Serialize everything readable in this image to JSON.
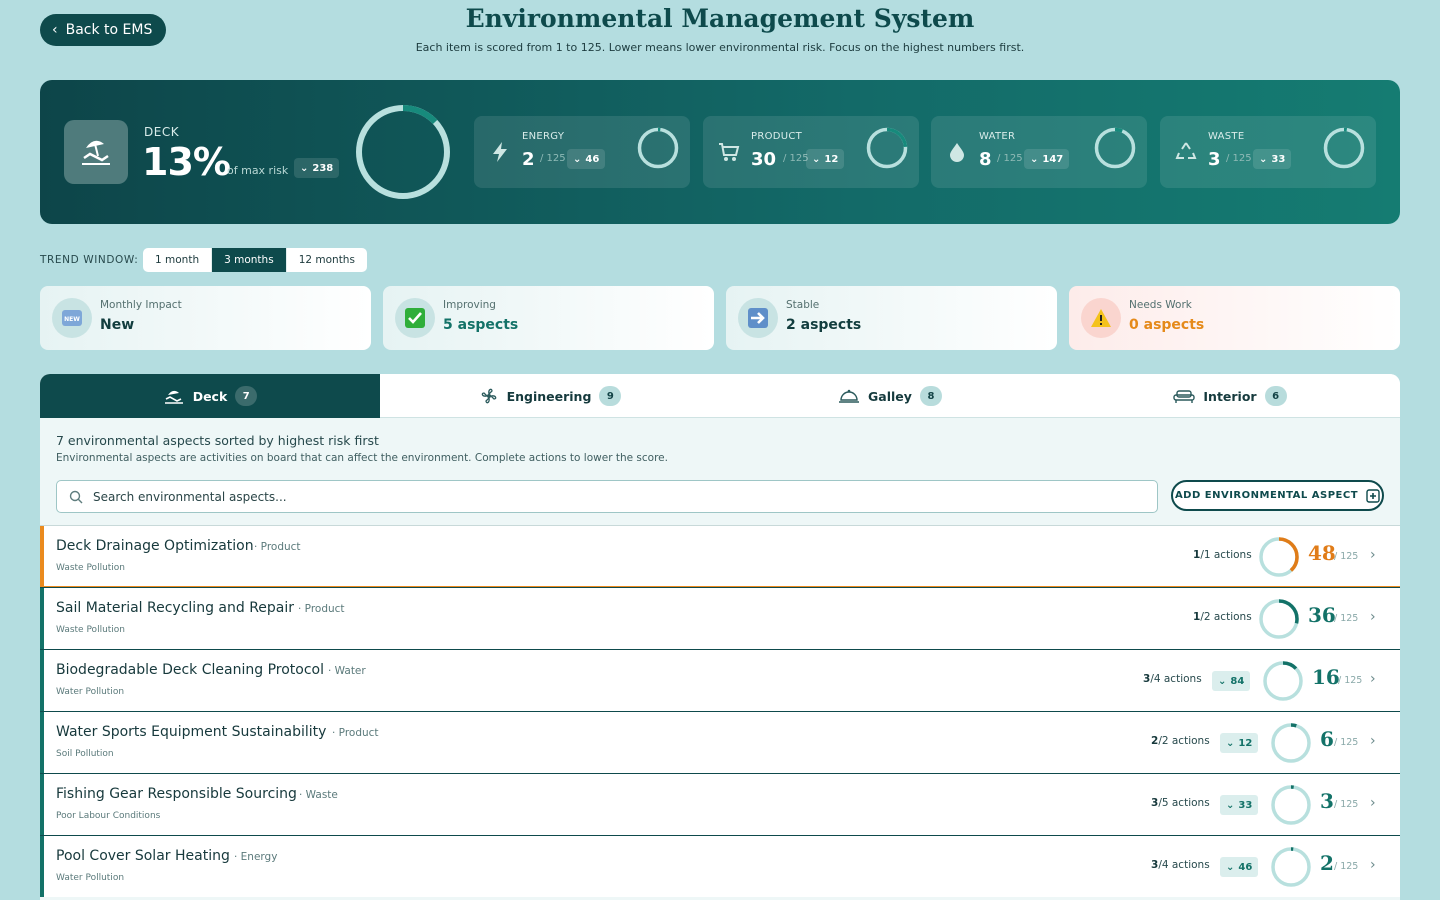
{
  "header": {
    "back_label": "Back to EMS",
    "title": "Environmental Management System",
    "subtitle": "Each item is scored from 1 to 125. Lower means lower environmental risk. Focus on the highest numbers first."
  },
  "hero": {
    "label": "DECK",
    "percent": "13%",
    "of_max": "of max risk",
    "trend_value": "238",
    "ring_fraction": 0.13,
    "categories": [
      {
        "name": "ENERGY",
        "icon": "lightning-icon",
        "score": "2",
        "max": "/ 125",
        "trend": "46",
        "fraction": 0.016
      },
      {
        "name": "PRODUCT",
        "icon": "cart-icon",
        "score": "30",
        "max": "/ 125",
        "trend": "12",
        "fraction": 0.24
      },
      {
        "name": "WATER",
        "icon": "droplet-icon",
        "score": "8",
        "max": "/ 125",
        "trend": "147",
        "fraction": 0.064
      },
      {
        "name": "WASTE",
        "icon": "recycle-icon",
        "score": "3",
        "max": "/ 125",
        "trend": "33",
        "fraction": 0.024
      }
    ]
  },
  "trend_window": {
    "label": "TREND WINDOW:",
    "options": [
      "1 month",
      "3 months",
      "12 months"
    ],
    "selected": "3 months"
  },
  "stats": [
    {
      "label": "Monthly Impact",
      "value": "New",
      "icon": "new-badge-icon"
    },
    {
      "label": "Improving",
      "value": "5 aspects",
      "icon": "check-box-icon"
    },
    {
      "label": "Stable",
      "value": "2 aspects",
      "icon": "arrow-right-box-icon"
    },
    {
      "label": "Needs Work",
      "value": "0 aspects",
      "icon": "warning-icon"
    }
  ],
  "tabs": [
    {
      "label": "Deck",
      "count": "7",
      "icon": "deck-chair-icon"
    },
    {
      "label": "Engineering",
      "count": "9",
      "icon": "fan-icon"
    },
    {
      "label": "Galley",
      "count": "8",
      "icon": "cloche-icon"
    },
    {
      "label": "Interior",
      "count": "6",
      "icon": "sofa-icon"
    }
  ],
  "list": {
    "heading": "7 environmental aspects sorted by highest risk first",
    "description": "Environmental aspects are activities on board that can affect the environment. Complete actions to lower the score.",
    "search_placeholder": "Search environmental aspects...",
    "add_label": "ADD ENVIRONMENTAL ASPECT",
    "colors": {
      "high": "#e07c18",
      "normal": "#137268"
    },
    "rows": [
      {
        "title": "Deck Drainage Optimization",
        "category": "· Product",
        "subcategory": "Waste Pollution",
        "done": "1",
        "total": "/1 actions",
        "trend": "",
        "score": "48",
        "max": "/ 125",
        "fraction": 0.384
      },
      {
        "title": "Sail Material Recycling and Repair",
        "category": "· Product",
        "subcategory": "Waste Pollution",
        "done": "1",
        "total": "/2 actions",
        "trend": "",
        "score": "36",
        "max": "/ 125",
        "fraction": 0.288
      },
      {
        "title": "Biodegradable Deck Cleaning Protocol",
        "category": "· Water",
        "subcategory": "Water Pollution",
        "done": "3",
        "total": "/4 actions",
        "trend": "84",
        "score": "16",
        "max": "/ 125",
        "fraction": 0.128
      },
      {
        "title": "Water Sports Equipment Sustainability",
        "category": "· Product",
        "subcategory": "Soil Pollution",
        "done": "2",
        "total": "/2 actions",
        "trend": "12",
        "score": "6",
        "max": "/ 125",
        "fraction": 0.048
      },
      {
        "title": "Fishing Gear Responsible Sourcing",
        "category": "· Waste",
        "subcategory": "Poor Labour Conditions",
        "done": "3",
        "total": "/5 actions",
        "trend": "33",
        "score": "3",
        "max": "/ 125",
        "fraction": 0.024
      },
      {
        "title": "Pool Cover Solar Heating",
        "category": "· Energy",
        "subcategory": "Water Pollution",
        "done": "3",
        "total": "/4 actions",
        "trend": "46",
        "score": "2",
        "max": "/ 125",
        "fraction": 0.016
      }
    ]
  }
}
